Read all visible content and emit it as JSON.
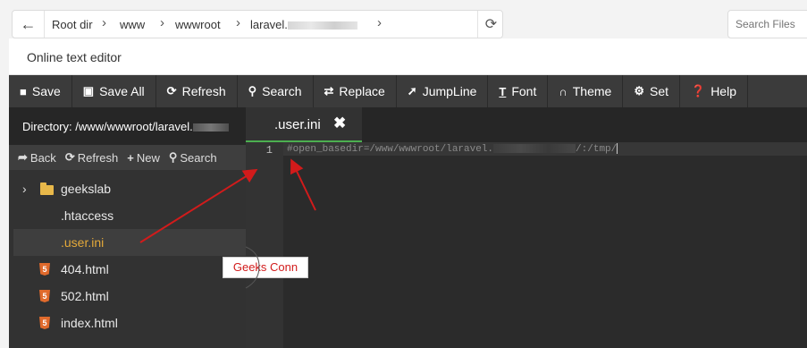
{
  "breadcrumb": {
    "back_icon": "arrow-left-icon",
    "items": [
      "Root dir",
      "www",
      "wwwroot",
      "laravel."
    ],
    "refresh_icon": "refresh-icon"
  },
  "search_files": {
    "placeholder": "Search Files"
  },
  "editor": {
    "title": "Online text editor",
    "toolbar": [
      {
        "label": "Save",
        "icon": "save-icon"
      },
      {
        "label": "Save All",
        "icon": "save-all-icon"
      },
      {
        "label": "Refresh",
        "icon": "refresh-icon"
      },
      {
        "label": "Search",
        "icon": "search-icon"
      },
      {
        "label": "Replace",
        "icon": "replace-icon"
      },
      {
        "label": "JumpLine",
        "icon": "pin-icon"
      },
      {
        "label": "Font",
        "icon": "font-icon"
      },
      {
        "label": "Theme",
        "icon": "magnet-icon"
      },
      {
        "label": "Set",
        "icon": "gear-icon"
      },
      {
        "label": "Help",
        "icon": "help-icon"
      }
    ],
    "sidebar": {
      "directory_label": "Directory: /www/wwwroot/laravel.",
      "actions": [
        {
          "label": "Back",
          "icon": "back-arrow-icon"
        },
        {
          "label": "Refresh",
          "icon": "refresh-icon"
        },
        {
          "label": "New",
          "icon": "plus-icon"
        },
        {
          "label": "Search",
          "icon": "search-icon"
        }
      ],
      "files": [
        {
          "name": "geekslab",
          "type": "folder"
        },
        {
          "name": ".htaccess",
          "type": "file"
        },
        {
          "name": ".user.ini",
          "type": "file",
          "selected": true
        },
        {
          "name": "404.html",
          "type": "html"
        },
        {
          "name": "502.html",
          "type": "html"
        },
        {
          "name": "index.html",
          "type": "html"
        }
      ]
    },
    "tab": {
      "label": ".user.ini",
      "close_icon": "close-icon"
    },
    "code": {
      "line_number": "1",
      "line_prefix": "#open_basedir=/www/wwwroot/laravel.",
      "line_suffix": "/:/tmp/"
    }
  },
  "annotation": {
    "callout": "Geeks Conn",
    "color": "#d21b1b"
  }
}
